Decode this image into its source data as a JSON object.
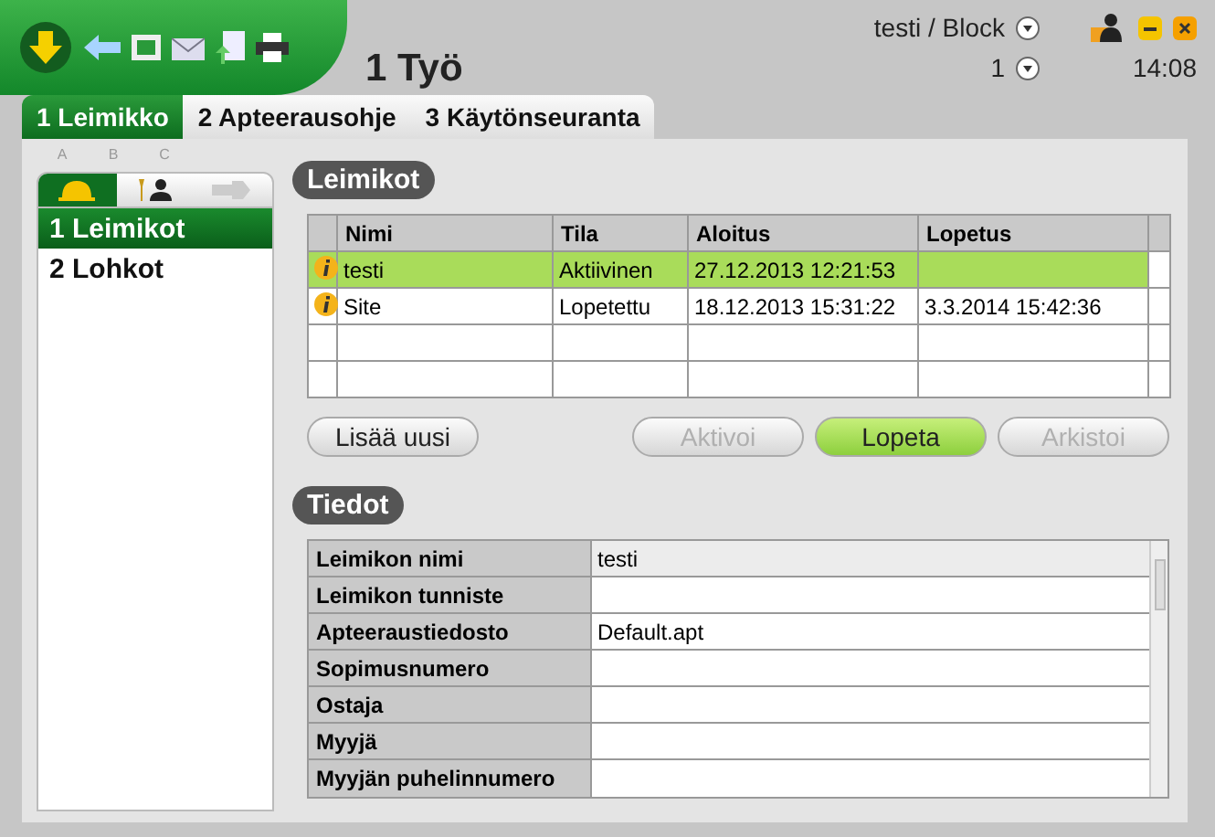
{
  "header": {
    "title": "1 Työ",
    "user": "testi / Block",
    "number": "1",
    "time": "14:08"
  },
  "tabs": [
    {
      "label": "1 Leimikko",
      "selected": true
    },
    {
      "label": "2 Apteerausohje",
      "selected": false
    },
    {
      "label": "3 Käytönseuranta",
      "selected": false
    }
  ],
  "sidebar": {
    "letters": [
      "A",
      "B",
      "C"
    ],
    "icon_tabs": [
      {
        "kind": "helmet",
        "selected": true
      },
      {
        "kind": "tools",
        "selected": false
      },
      {
        "kind": "plug",
        "selected": false
      }
    ],
    "items": [
      {
        "label": "1 Leimikot",
        "selected": true
      },
      {
        "label": "2 Lohkot",
        "selected": false
      }
    ]
  },
  "leimikot": {
    "title": "Leimikot",
    "columns": [
      "Nimi",
      "Tila",
      "Aloitus",
      "Lopetus"
    ],
    "rows": [
      {
        "cells": [
          "testi",
          "Aktiivinen",
          "27.12.2013 12:21:53",
          ""
        ],
        "selected": true
      },
      {
        "cells": [
          "Site",
          "Lopetettu",
          "18.12.2013 15:31:22",
          "3.3.2014 15:42:36"
        ],
        "selected": false
      }
    ]
  },
  "buttons": [
    {
      "label": "Lisää uusi",
      "disabled": false,
      "kind": "normal"
    },
    {
      "label": "Aktivoi",
      "disabled": true,
      "kind": "normal"
    },
    {
      "label": "Lopeta",
      "disabled": false,
      "kind": "primary"
    },
    {
      "label": "Arkistoi",
      "disabled": true,
      "kind": "normal"
    }
  ],
  "tiedot": {
    "title": "Tiedot",
    "fields": [
      {
        "label": "Leimikon nimi",
        "value": "testi",
        "readonly": true
      },
      {
        "label": "Leimikon tunniste",
        "readonly": false
      },
      {
        "label": "Apteeraustiedosto",
        "value": "Default.apt",
        "readonly": false
      },
      {
        "label": "Sopimusnumero",
        "readonly": false
      },
      {
        "label": "Ostaja",
        "readonly": false
      },
      {
        "label": "Myyjä",
        "readonly": false
      },
      {
        "label": "Myyjän puhelinnumero",
        "readonly": false
      }
    ]
  }
}
